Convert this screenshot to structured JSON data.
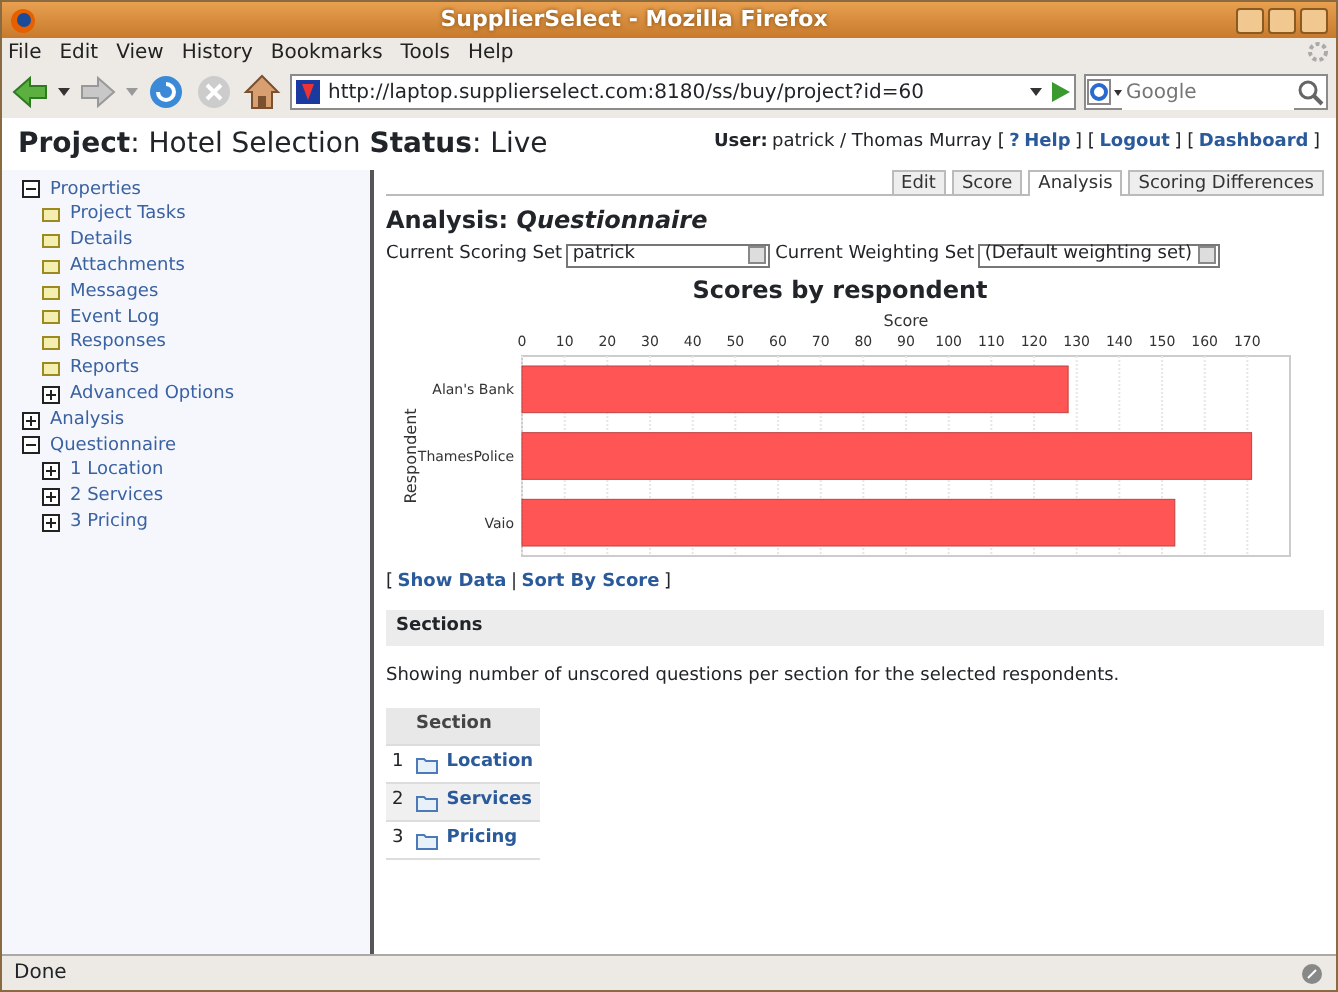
{
  "window": {
    "title": "SupplierSelect - Mozilla Firefox"
  },
  "menu": [
    "File",
    "Edit",
    "View",
    "History",
    "Bookmarks",
    "Tools",
    "Help"
  ],
  "toolbar": {
    "url": "http://laptop.supplierselect.com:8180/ss/buy/project?id=60",
    "search_placeholder": "Google"
  },
  "header": {
    "project_label": "Project",
    "project_name": ": Hotel Selection",
    "status_label": "Status",
    "status_value": ": Live",
    "user_label": "User:",
    "user_value": "patrick / Thomas Murray [",
    "help_mark": "?",
    "help": "Help",
    "sep1": "] [",
    "logout": "Logout",
    "sep2": "] [",
    "dashboard": "Dashboard",
    "end": "]"
  },
  "sidebar": {
    "items": [
      {
        "label": "Properties",
        "kind": "folder",
        "expanded": true,
        "children": [
          {
            "label": "Project Tasks",
            "kind": "page"
          },
          {
            "label": "Details",
            "kind": "page"
          },
          {
            "label": "Attachments",
            "kind": "page"
          },
          {
            "label": "Messages",
            "kind": "page"
          },
          {
            "label": "Event Log",
            "kind": "page"
          },
          {
            "label": "Responses",
            "kind": "page"
          },
          {
            "label": "Reports",
            "kind": "page"
          },
          {
            "label": "Advanced Options",
            "kind": "folder",
            "expanded": false
          }
        ]
      },
      {
        "label": "Analysis",
        "kind": "folder",
        "expanded": false
      },
      {
        "label": "Questionnaire",
        "kind": "folder",
        "expanded": true,
        "children": [
          {
            "label": "1 Location",
            "kind": "folder",
            "expanded": false
          },
          {
            "label": "2 Services",
            "kind": "folder",
            "expanded": false
          },
          {
            "label": "3 Pricing",
            "kind": "folder",
            "expanded": false
          }
        ]
      }
    ]
  },
  "tabs": [
    {
      "label": "Edit",
      "selected": false
    },
    {
      "label": "Score",
      "selected": false
    },
    {
      "label": "Analysis",
      "selected": true
    },
    {
      "label": "Scoring Differences",
      "selected": false
    }
  ],
  "analysis": {
    "title_label": "Analysis:",
    "title_value": "Questionnaire",
    "scoring_label": "Current Scoring Set",
    "scoring_value": "patrick",
    "weighting_label": "Current Weighting Set",
    "weighting_value": "(Default weighting set)",
    "chart_data": {
      "type": "bar",
      "orientation": "horizontal",
      "title": "Scores by respondent",
      "xlabel": "Score",
      "ylabel": "Respondent",
      "categories": [
        "Alan's Bank",
        "ThamesPolice",
        "Vaio"
      ],
      "series": [
        {
          "color": "#ff5555",
          "values": [
            128,
            171,
            153
          ]
        }
      ],
      "grid": true,
      "xlim": [
        0,
        180
      ],
      "xticks": [
        0,
        10,
        20,
        30,
        40,
        50,
        60,
        70,
        80,
        90,
        100,
        110,
        120,
        130,
        140,
        150,
        160,
        170
      ]
    },
    "links_open": "[",
    "show_data": "Show Data",
    "links_sep": "|",
    "sort": "Sort By Score",
    "links_close": "]"
  },
  "sections": {
    "title": "Sections",
    "note": "Showing number of unscored questions per section for the selected respondents.",
    "column": "Section",
    "rows": [
      {
        "number": "1",
        "name": "Location"
      },
      {
        "number": "2",
        "name": "Services"
      },
      {
        "number": "3",
        "name": "Pricing"
      }
    ]
  },
  "status_bar": {
    "text": "Done"
  }
}
